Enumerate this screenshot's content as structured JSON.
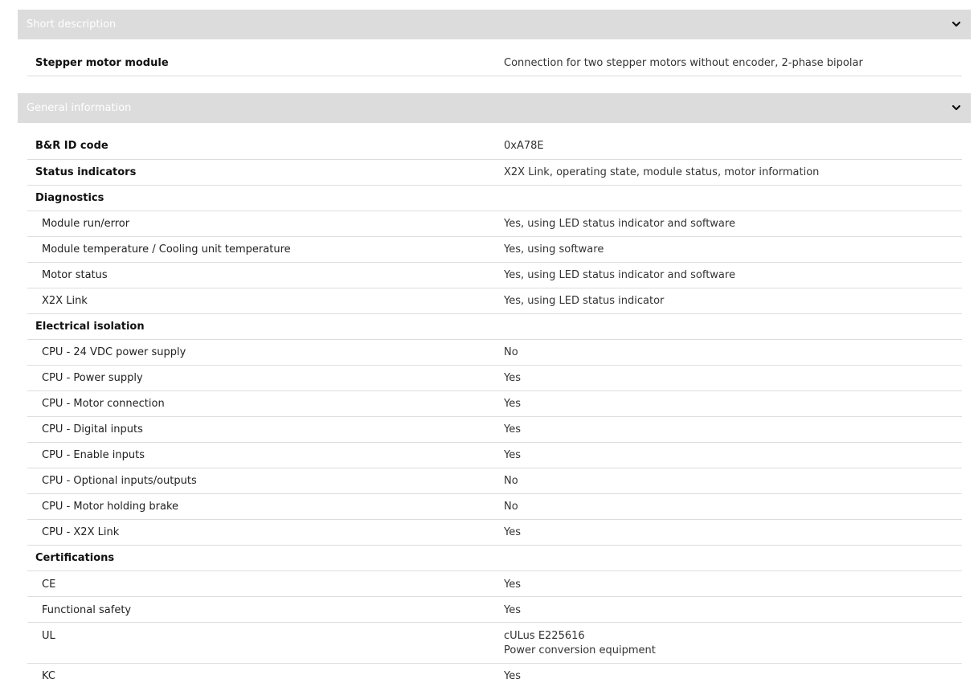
{
  "sections": [
    {
      "title": "Short description",
      "rows": [
        {
          "label": "Stepper motor module",
          "value": "Connection for two stepper motors without encoder, 2-phase bipolar"
        }
      ]
    },
    {
      "title": "General information",
      "rows": [
        {
          "label": "B&R ID code",
          "value": "0xA78E"
        },
        {
          "label": "Status indicators",
          "value": "X2X Link, operating state, module status, motor information"
        },
        {
          "label": "Diagnostics",
          "value": ""
        },
        {
          "label": "Module run/error",
          "value": "Yes, using LED status indicator and software"
        },
        {
          "label": "Module temperature / Cooling unit temperature",
          "value": "Yes, using software"
        },
        {
          "label": "Motor status",
          "value": "Yes, using LED status indicator and software"
        },
        {
          "label": "X2X Link",
          "value": "Yes, using LED status indicator"
        },
        {
          "label": "Electrical isolation",
          "value": ""
        },
        {
          "label": "CPU - 24 VDC power supply",
          "value": "No"
        },
        {
          "label": "CPU - Power supply",
          "value": "Yes"
        },
        {
          "label": "CPU - Motor connection",
          "value": "Yes"
        },
        {
          "label": "CPU - Digital inputs",
          "value": "Yes"
        },
        {
          "label": "CPU - Enable inputs",
          "value": "Yes"
        },
        {
          "label": "CPU - Optional inputs/outputs",
          "value": "No"
        },
        {
          "label": "CPU - Motor holding brake",
          "value": "No"
        },
        {
          "label": "CPU - X2X Link",
          "value": "Yes"
        },
        {
          "label": "Certifications",
          "value": ""
        },
        {
          "label": "CE",
          "value": "Yes"
        },
        {
          "label": "Functional safety",
          "value": "Yes"
        },
        {
          "label": "UL",
          "value": "cULus E225616",
          "value2": "Power conversion equipment"
        },
        {
          "label": "KC",
          "value": "Yes"
        }
      ]
    }
  ]
}
